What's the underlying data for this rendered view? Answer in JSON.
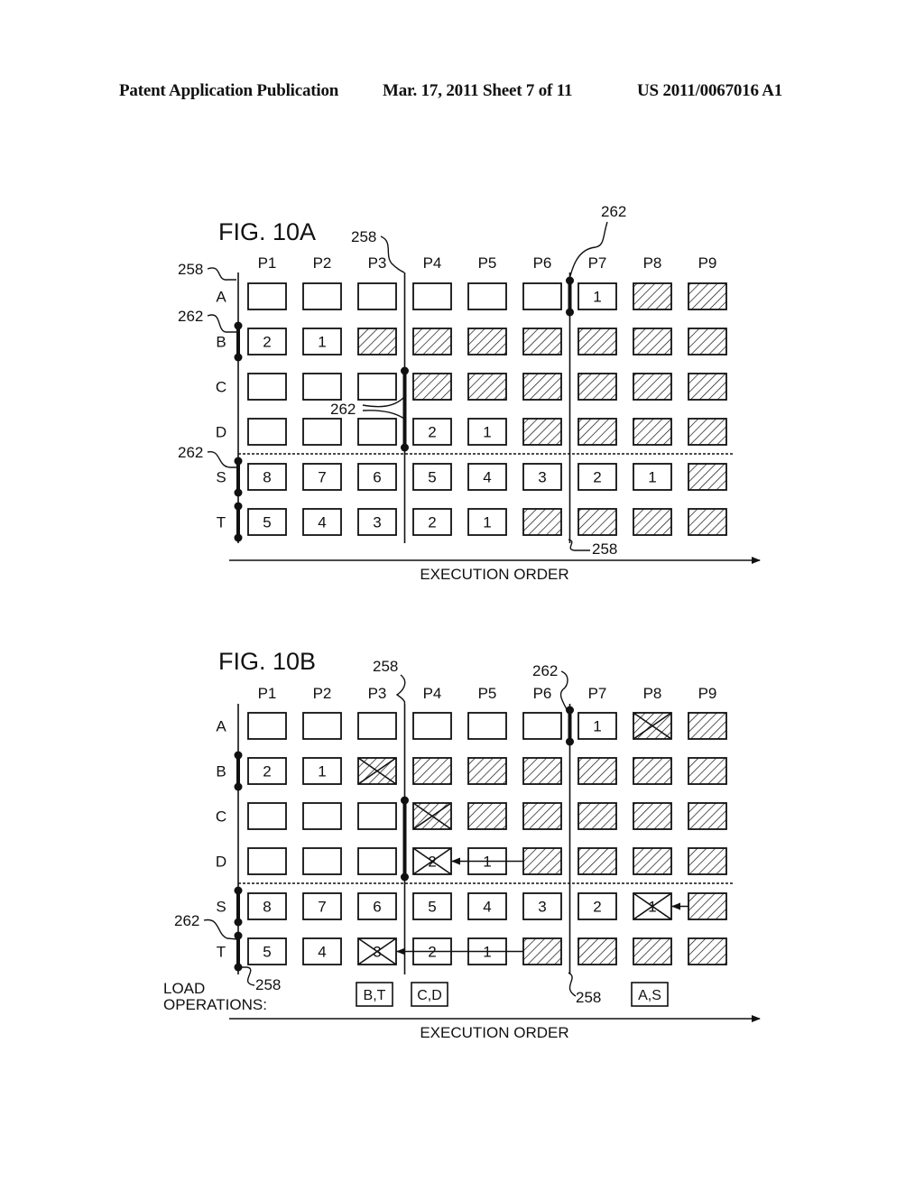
{
  "header": {
    "publication": "Patent Application Publication",
    "date_sheet": "Mar. 17, 2011  Sheet 7 of 11",
    "number": "US 2011/0067016 A1"
  },
  "figures": [
    {
      "id": "fig10a",
      "title": "FIG. 10A",
      "columns": [
        "P1",
        "P2",
        "P3",
        "P4",
        "P5",
        "P6",
        "P7",
        "P8",
        "P9"
      ],
      "rows": [
        "A",
        "B",
        "C",
        "D",
        "S",
        "T"
      ],
      "cells": [
        [
          {
            "t": "empty"
          },
          {
            "t": "empty"
          },
          {
            "t": "empty"
          },
          {
            "t": "empty"
          },
          {
            "t": "empty"
          },
          {
            "t": "empty"
          },
          {
            "t": "num",
            "v": "1"
          },
          {
            "t": "hatch"
          },
          {
            "t": "hatch"
          }
        ],
        [
          {
            "t": "num",
            "v": "2"
          },
          {
            "t": "num",
            "v": "1"
          },
          {
            "t": "hatch"
          },
          {
            "t": "hatch"
          },
          {
            "t": "hatch"
          },
          {
            "t": "hatch"
          },
          {
            "t": "hatch"
          },
          {
            "t": "hatch"
          },
          {
            "t": "hatch"
          }
        ],
        [
          {
            "t": "empty"
          },
          {
            "t": "empty"
          },
          {
            "t": "empty"
          },
          {
            "t": "hatch"
          },
          {
            "t": "hatch"
          },
          {
            "t": "hatch"
          },
          {
            "t": "hatch"
          },
          {
            "t": "hatch"
          },
          {
            "t": "hatch"
          }
        ],
        [
          {
            "t": "empty"
          },
          {
            "t": "empty"
          },
          {
            "t": "empty"
          },
          {
            "t": "num",
            "v": "2"
          },
          {
            "t": "num",
            "v": "1"
          },
          {
            "t": "hatch"
          },
          {
            "t": "hatch"
          },
          {
            "t": "hatch"
          },
          {
            "t": "hatch"
          }
        ],
        [
          {
            "t": "num",
            "v": "8"
          },
          {
            "t": "num",
            "v": "7"
          },
          {
            "t": "num",
            "v": "6"
          },
          {
            "t": "num",
            "v": "5"
          },
          {
            "t": "num",
            "v": "4"
          },
          {
            "t": "num",
            "v": "3"
          },
          {
            "t": "num",
            "v": "2"
          },
          {
            "t": "num",
            "v": "1"
          },
          {
            "t": "hatch"
          }
        ],
        [
          {
            "t": "num",
            "v": "5"
          },
          {
            "t": "num",
            "v": "4"
          },
          {
            "t": "num",
            "v": "3"
          },
          {
            "t": "num",
            "v": "2"
          },
          {
            "t": "num",
            "v": "1"
          },
          {
            "t": "hatch"
          },
          {
            "t": "hatch"
          },
          {
            "t": "hatch"
          },
          {
            "t": "hatch"
          }
        ]
      ],
      "boundaries": [
        {
          "before_col": 0,
          "dots": [
            [
              1,
              1
            ],
            [
              4,
              4
            ],
            [
              5,
              5
            ]
          ]
        },
        {
          "before_col": 3,
          "dots": [
            [
              2,
              3
            ]
          ]
        },
        {
          "before_col": 6,
          "dots": [
            [
              0,
              0
            ]
          ]
        }
      ],
      "arrows": [],
      "refs": [
        "258",
        "258",
        "262",
        "262",
        "262",
        "262",
        "258"
      ],
      "load_label": "",
      "load_ops": [],
      "axis_label": "EXECUTION ORDER"
    },
    {
      "id": "fig10b",
      "title": "FIG. 10B",
      "columns": [
        "P1",
        "P2",
        "P3",
        "P4",
        "P5",
        "P6",
        "P7",
        "P8",
        "P9"
      ],
      "rows": [
        "A",
        "B",
        "C",
        "D",
        "S",
        "T"
      ],
      "cells": [
        [
          {
            "t": "empty"
          },
          {
            "t": "empty"
          },
          {
            "t": "empty"
          },
          {
            "t": "empty"
          },
          {
            "t": "empty"
          },
          {
            "t": "empty"
          },
          {
            "t": "num",
            "v": "1"
          },
          {
            "t": "hatchx"
          },
          {
            "t": "hatch"
          }
        ],
        [
          {
            "t": "num",
            "v": "2"
          },
          {
            "t": "num",
            "v": "1"
          },
          {
            "t": "hatchx"
          },
          {
            "t": "hatch"
          },
          {
            "t": "hatch"
          },
          {
            "t": "hatch"
          },
          {
            "t": "hatch"
          },
          {
            "t": "hatch"
          },
          {
            "t": "hatch"
          }
        ],
        [
          {
            "t": "empty"
          },
          {
            "t": "empty"
          },
          {
            "t": "empty"
          },
          {
            "t": "hatchx"
          },
          {
            "t": "hatch"
          },
          {
            "t": "hatch"
          },
          {
            "t": "hatch"
          },
          {
            "t": "hatch"
          },
          {
            "t": "hatch"
          }
        ],
        [
          {
            "t": "empty"
          },
          {
            "t": "empty"
          },
          {
            "t": "empty"
          },
          {
            "t": "numx",
            "v": "2"
          },
          {
            "t": "num",
            "v": "1"
          },
          {
            "t": "hatch"
          },
          {
            "t": "hatch"
          },
          {
            "t": "hatch"
          },
          {
            "t": "hatch"
          }
        ],
        [
          {
            "t": "num",
            "v": "8"
          },
          {
            "t": "num",
            "v": "7"
          },
          {
            "t": "num",
            "v": "6"
          },
          {
            "t": "num",
            "v": "5"
          },
          {
            "t": "num",
            "v": "4"
          },
          {
            "t": "num",
            "v": "3"
          },
          {
            "t": "num",
            "v": "2"
          },
          {
            "t": "numx",
            "v": "1"
          },
          {
            "t": "hatch"
          }
        ],
        [
          {
            "t": "num",
            "v": "5"
          },
          {
            "t": "num",
            "v": "4"
          },
          {
            "t": "numx",
            "v": "3"
          },
          {
            "t": "num",
            "v": "2"
          },
          {
            "t": "num",
            "v": "1"
          },
          {
            "t": "hatch"
          },
          {
            "t": "hatch"
          },
          {
            "t": "hatch"
          },
          {
            "t": "hatch"
          }
        ]
      ],
      "boundaries": [
        {
          "before_col": 0,
          "dots": [
            [
              1,
              1
            ],
            [
              4,
              4
            ],
            [
              5,
              5
            ]
          ]
        },
        {
          "before_col": 3,
          "dots": [
            [
              2,
              3
            ]
          ]
        },
        {
          "before_col": 6,
          "dots": [
            [
              0,
              0
            ]
          ]
        }
      ],
      "arrows": [
        {
          "row": 3,
          "from_col": 5,
          "to_col": 3
        },
        {
          "row": 4,
          "from_col": 8,
          "to_col": 7
        },
        {
          "row": 5,
          "from_col": 5,
          "to_col": 2
        }
      ],
      "refs": [
        "258",
        "262",
        "262",
        "258",
        "258"
      ],
      "load_label_1": "LOAD",
      "load_label_2": "OPERATIONS:",
      "load_ops": [
        {
          "col": 2,
          "label": "B,T"
        },
        {
          "col": 3,
          "label": "C,D"
        },
        {
          "col": 7,
          "label": "A,S"
        }
      ],
      "axis_label": "EXECUTION ORDER"
    }
  ]
}
